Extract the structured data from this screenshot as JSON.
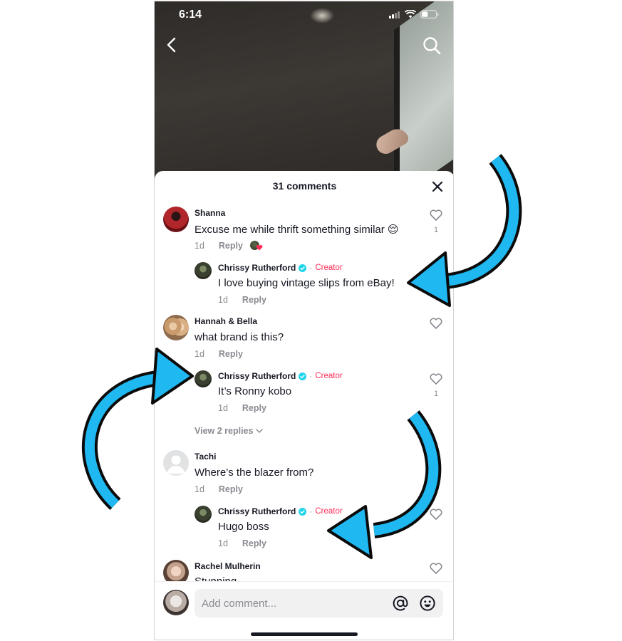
{
  "status_bar": {
    "time": "6:14"
  },
  "sheet": {
    "title": "31 comments"
  },
  "comments": [
    {
      "name": "Shanna",
      "text": "Excuse me while thrift something similar 😌",
      "time": "1d",
      "reply_label": "Reply",
      "likes": "1",
      "liked_by_creator": true
    },
    {
      "name": "Chrissy Rutherford",
      "badge": "Creator",
      "text": "I love buying vintage slips from eBay!",
      "time": "1d",
      "reply_label": "Reply"
    },
    {
      "name": "Hannah & Bella",
      "text": "what brand is this?",
      "time": "1d",
      "reply_label": "Reply"
    },
    {
      "name": "Chrissy Rutherford",
      "badge": "Creator",
      "text": "It’s Ronny kobo",
      "time": "1d",
      "reply_label": "Reply",
      "likes": "1"
    },
    {
      "name": "Tachi",
      "text": "Where’s the blazer from?",
      "time": "1d",
      "reply_label": "Reply"
    },
    {
      "name": "Chrissy Rutherford",
      "badge": "Creator",
      "text": "Hugo boss",
      "time": "1d",
      "reply_label": "Reply"
    },
    {
      "name": "Rachel Mulherin",
      "text": "Stunning"
    }
  ],
  "view_replies": "View 2 replies",
  "composer": {
    "placeholder": "Add comment..."
  },
  "colors": {
    "creator_red": "#fe2c55",
    "verified_cyan": "#20d5ec",
    "arrow_blue": "#1fb8f1"
  },
  "icons": [
    "back-icon",
    "search-icon",
    "close-icon",
    "heart-icon",
    "verified-icon",
    "at-sign-icon",
    "emoji-icon",
    "chevron-down-icon"
  ]
}
